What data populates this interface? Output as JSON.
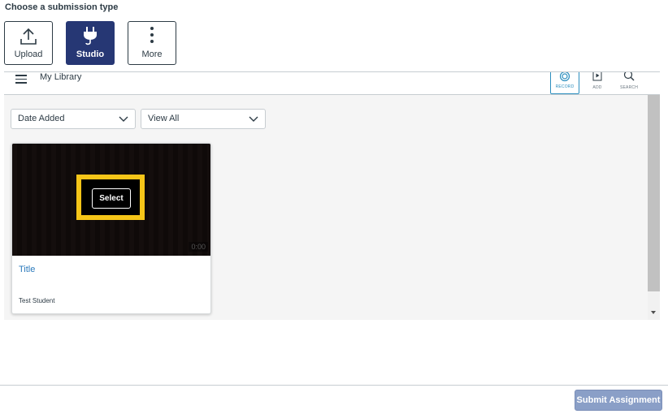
{
  "heading": "Choose a submission type",
  "submission_types": [
    {
      "label": "Upload",
      "icon": "upload-icon"
    },
    {
      "label": "Studio",
      "icon": "plug-icon",
      "active": true
    },
    {
      "label": "More",
      "icon": "more-vertical-icon"
    }
  ],
  "studio": {
    "library_title": "My Library",
    "tools": [
      {
        "label": "RECORD",
        "icon": "record-icon"
      },
      {
        "label": "ADD",
        "icon": "add-media-icon"
      },
      {
        "label": "SEARCH",
        "icon": "search-icon"
      }
    ],
    "sort_dropdown": "Date Added",
    "filter_dropdown": "View All",
    "media_card": {
      "select_label": "Select",
      "duration": "0:00",
      "title": "Title",
      "owner": "Test Student"
    }
  },
  "submit_label": "Submit Assignment",
  "colors": {
    "active_type": "#263774",
    "highlight": "#f5c518",
    "link": "#2b7abc",
    "submit_disabled": "#8a9fc7"
  }
}
